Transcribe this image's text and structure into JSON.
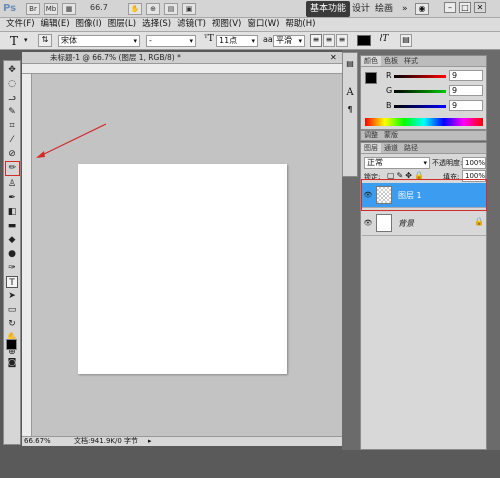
{
  "app": {
    "logo": "Ps",
    "zoom": "66.7",
    "title_btn_labels": [
      "Br",
      "Mb"
    ]
  },
  "workspace": {
    "active": "基本功能",
    "items": [
      "设计",
      "绘画"
    ],
    "more": "»"
  },
  "menu": [
    "文件(F)",
    "编辑(E)",
    "图像(I)",
    "图层(L)",
    "选择(S)",
    "滤镜(T)",
    "视图(V)",
    "窗口(W)",
    "帮助(H)"
  ],
  "options": {
    "font_family": "宋体",
    "font_style": "-",
    "font_size": "11点",
    "antialias": "平滑",
    "tool_glyph": "T"
  },
  "document": {
    "tab_title": "未标题-1 @ 66.7% (图层 1, RGB/8) *",
    "zoom_status": "66.67%",
    "doc_status": "文档:941.9K/0 字节"
  },
  "color_panel": {
    "tabs": [
      "颜色",
      "色板",
      "样式"
    ],
    "channels": [
      {
        "label": "R",
        "value": "9"
      },
      {
        "label": "G",
        "value": "9"
      },
      {
        "label": "B",
        "value": "9"
      }
    ]
  },
  "adjust_panel": {
    "tabs": [
      "调整",
      "蒙版"
    ]
  },
  "layers_panel": {
    "tabs": [
      "图层",
      "通道",
      "路径"
    ],
    "blend_mode": "正常",
    "opacity_label": "不透明度:",
    "opacity_value": "100%",
    "lock_label": "锁定:",
    "fill_label": "填充:",
    "fill_value": "100%",
    "layers": [
      {
        "name": "图层 1",
        "selected": true
      },
      {
        "name": "背景",
        "selected": false
      }
    ]
  },
  "colors": {
    "accent": "#3b9cf0",
    "highlight": "#d42a2a"
  }
}
